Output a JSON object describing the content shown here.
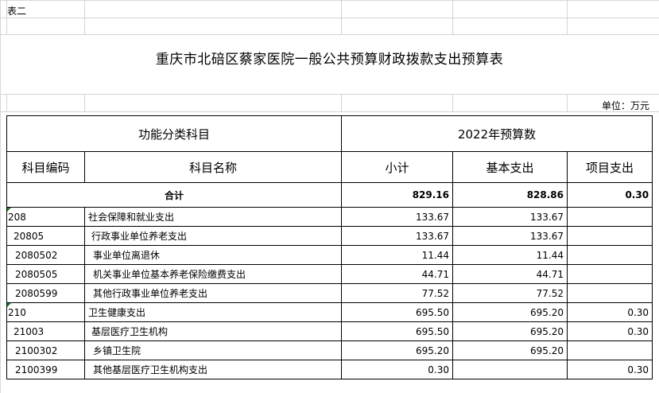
{
  "sheet_label": "表二",
  "title": "重庆市北碚区蔡家医院一般公共预算财政拨款支出预算表",
  "unit": "单位：万元",
  "header": {
    "group_left": "功能分类科目",
    "group_right": "2022年预算数",
    "col_code": "科目编码",
    "col_name": "科目名称",
    "col_subtotal": "小计",
    "col_basic": "基本支出",
    "col_project": "项目支出"
  },
  "total": {
    "label": "合计",
    "subtotal": "829.16",
    "basic": "828.86",
    "project": "0.30"
  },
  "rows": [
    {
      "code": "208",
      "name": "社会保障和就业支出",
      "subtotal": "133.67",
      "basic": "133.67",
      "project": ""
    },
    {
      "code": "20805",
      "name": "行政事业单位养老支出",
      "subtotal": "133.67",
      "basic": "133.67",
      "project": ""
    },
    {
      "code": "2080502",
      "name": "事业单位离退休",
      "subtotal": "11.44",
      "basic": "11.44",
      "project": ""
    },
    {
      "code": "2080505",
      "name": "机关事业单位基本养老保险缴费支出",
      "subtotal": "44.71",
      "basic": "44.71",
      "project": ""
    },
    {
      "code": "2080599",
      "name": "其他行政事业单位养老支出",
      "subtotal": "77.52",
      "basic": "77.52",
      "project": ""
    },
    {
      "code": "210",
      "name": "卫生健康支出",
      "subtotal": "695.50",
      "basic": "695.20",
      "project": "0.30"
    },
    {
      "code": "21003",
      "name": "基层医疗卫生机构",
      "subtotal": "695.50",
      "basic": "695.20",
      "project": "0.30"
    },
    {
      "code": "2100302",
      "name": "乡镇卫生院",
      "subtotal": "695.20",
      "basic": "695.20",
      "project": ""
    },
    {
      "code": "2100399",
      "name": "其他基层医疗卫生机构支出",
      "subtotal": "0.30",
      "basic": "",
      "project": "0.30"
    }
  ]
}
